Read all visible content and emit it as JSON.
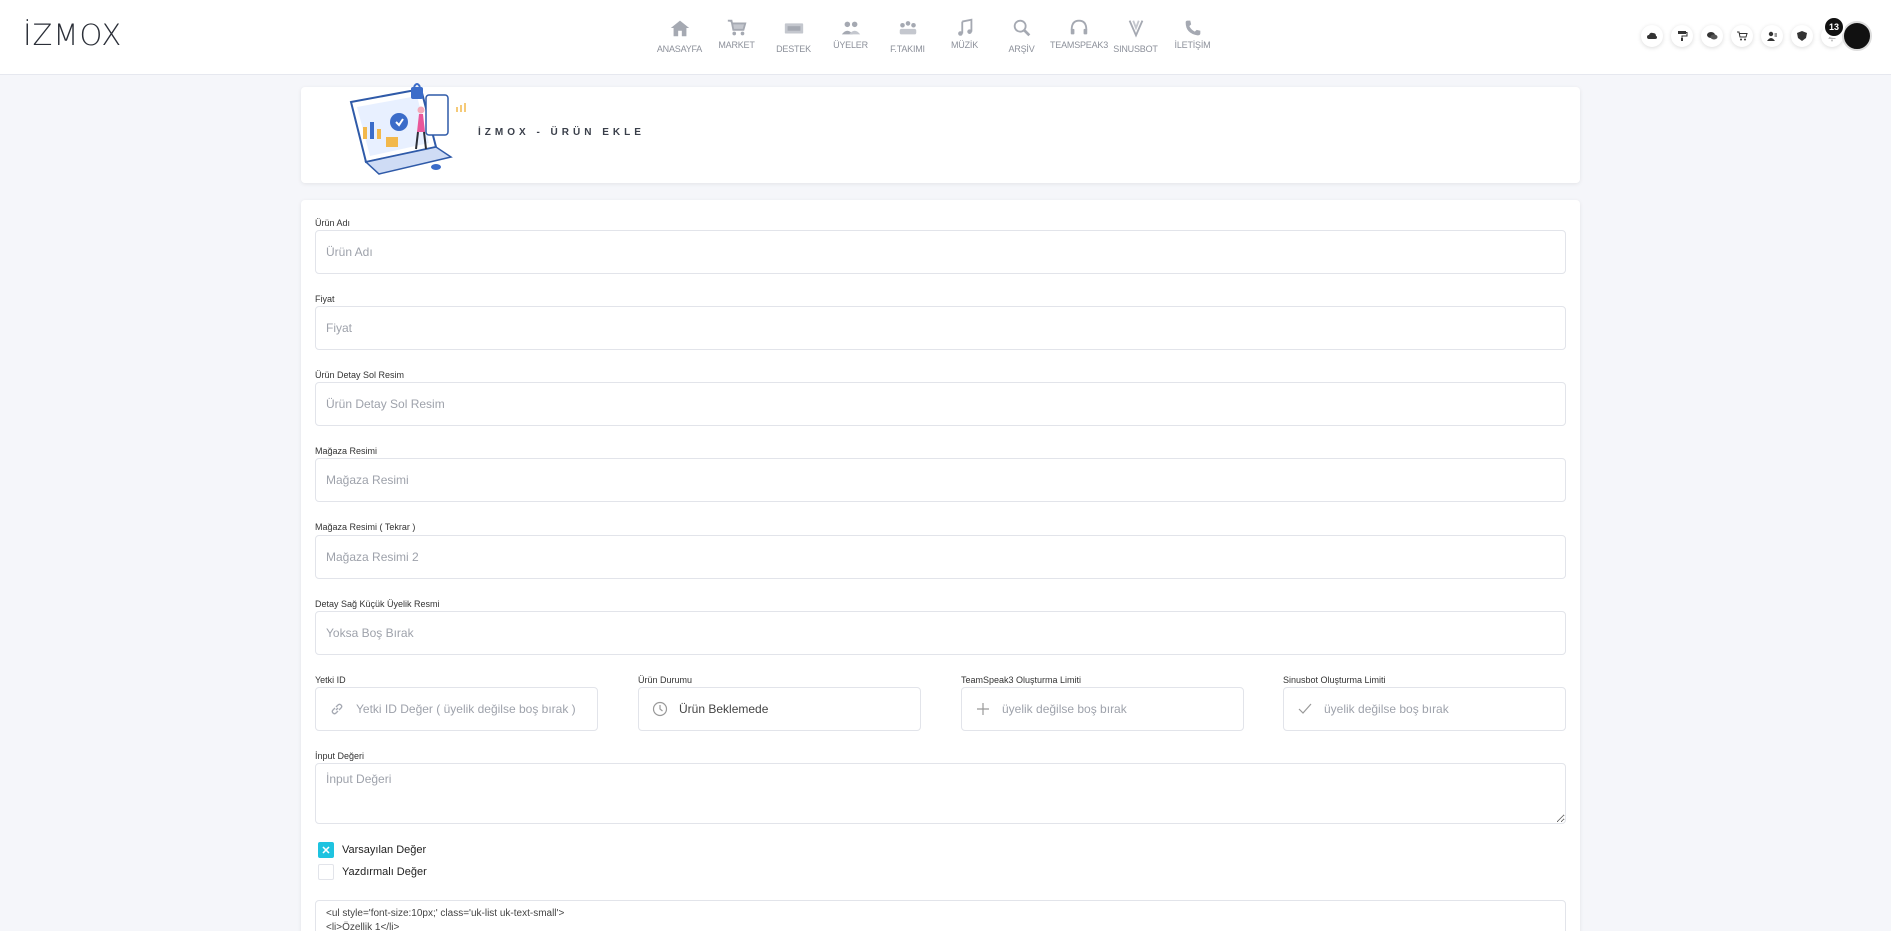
{
  "header": {
    "logo": "İZMOX",
    "nav": [
      {
        "label": "ANASAYFA",
        "icon": "home-icon"
      },
      {
        "label": "MARKET",
        "icon": "cart-icon"
      },
      {
        "label": "DESTEK",
        "icon": "ticket-icon"
      },
      {
        "label": "ÜYELER",
        "icon": "users-icon"
      },
      {
        "label": "F.TAKIMI",
        "icon": "team-icon"
      },
      {
        "label": "MÜZİK",
        "icon": "music-icon"
      },
      {
        "label": "ARŞİV",
        "icon": "search-icon"
      },
      {
        "label": "TEAMSPEAK3",
        "icon": "headset-icon"
      },
      {
        "label": "SINUSBOT",
        "icon": "sinusbot-icon"
      },
      {
        "label": "İLETİŞİM",
        "icon": "phone-icon"
      }
    ],
    "right_icons": [
      "cloud-icon",
      "paint-roller-icon",
      "chat-icon",
      "cart-icon",
      "user-icon",
      "shield-icon",
      "bell-icon"
    ],
    "notification_count": "13"
  },
  "banner": {
    "title": "İZMOX - ÜRÜN EKLE",
    "illustration": "laptop-security-illustration"
  },
  "form": {
    "product_name": {
      "label": "Ürün Adı",
      "placeholder": "Ürün Adı"
    },
    "price": {
      "label": "Fiyat",
      "placeholder": "Fiyat"
    },
    "detail_left_image": {
      "label": "Ürün Detay Sol Resim",
      "placeholder": "Ürün Detay Sol Resim"
    },
    "store_image": {
      "label": "Mağaza Resimi",
      "placeholder": "Mağaza Resimi"
    },
    "store_image_repeat": {
      "label": "Mağaza Resimi ( Tekrar )",
      "placeholder": "Mağaza Resimi 2"
    },
    "detail_right_small": {
      "label": "Detay Sağ Küçük Üyelik Resmi",
      "placeholder": "Yoksa Boş Bırak"
    },
    "permission_id": {
      "label": "Yetki ID",
      "placeholder": "Yetki ID Değer ( üyelik değilse boş bırak )",
      "icon": "link-icon"
    },
    "product_status": {
      "label": "Ürün Durumu",
      "value": "Ürün Beklemede",
      "icon": "clock-icon"
    },
    "ts3_limit": {
      "label": "TeamSpeak3 Oluşturma Limiti",
      "placeholder": "üyelik değilse boş bırak",
      "icon": "plus-icon"
    },
    "sinusbot_limit": {
      "label": "Sinusbot Oluşturma Limiti",
      "placeholder": "üyelik değilse boş bırak",
      "icon": "check-icon"
    },
    "input_value": {
      "label": "İnput Değeri",
      "placeholder": "İnput Değeri"
    },
    "default_value": {
      "label": "Varsayılan Değer",
      "checked": true
    },
    "printable_value": {
      "label": "Yazdırmalı Değer",
      "checked": false
    },
    "code_lines": [
      "<ul style='font-size:10px;' class='uk-list uk-text-small'>",
      "<li>Özellik 1</li>"
    ]
  },
  "colors": {
    "accent": "#1ec3e0",
    "icon_gray": "#a5a9b2"
  }
}
